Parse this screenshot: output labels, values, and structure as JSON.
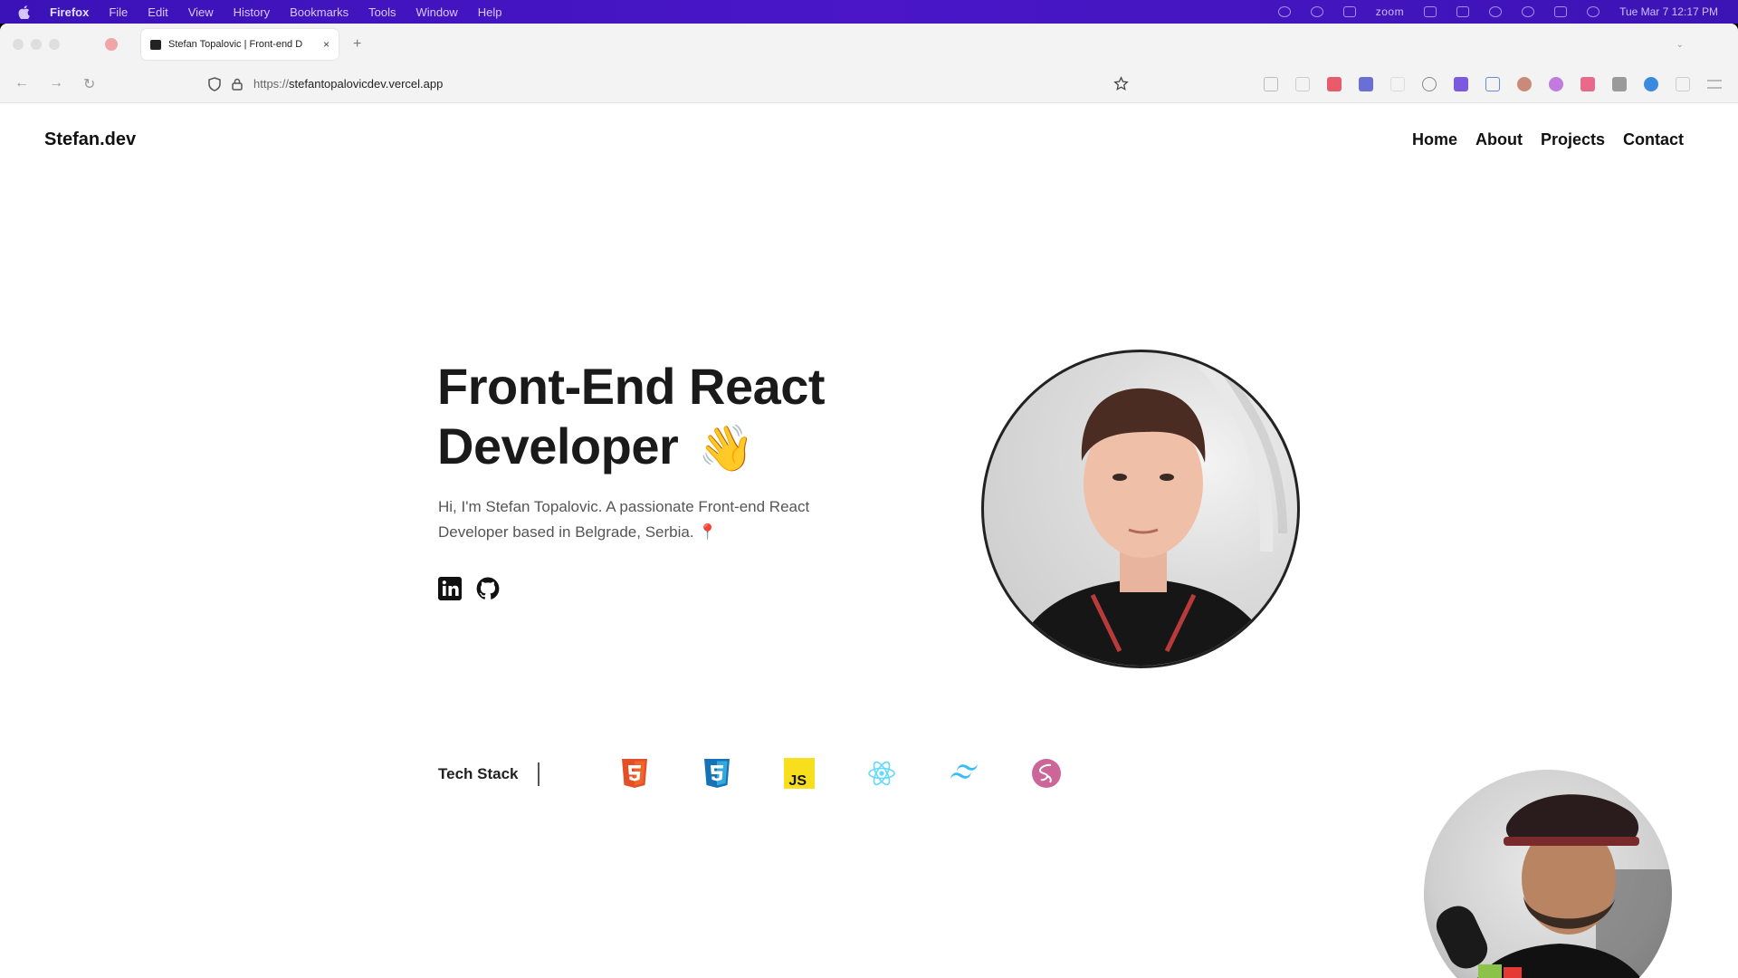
{
  "menubar": {
    "app_name": "Firefox",
    "items": [
      "File",
      "Edit",
      "View",
      "History",
      "Bookmarks",
      "Tools",
      "Window",
      "Help"
    ],
    "zoom_label": "zoom",
    "clock": "Tue Mar 7 12:17 PM"
  },
  "browser": {
    "tab_title": "Stefan Topalovic | Front-end D",
    "tab_close": "×",
    "new_tab": "+",
    "url_prefix": "https://",
    "url_host": "stefantopalovicdev.vercel.app"
  },
  "site": {
    "logo": "Stefan.dev",
    "nav": [
      "Home",
      "About",
      "Projects",
      "Contact"
    ],
    "hero_title_line1": "Front-End React",
    "hero_title_line2": "Developer",
    "hero_emoji": "👋",
    "hero_text": "Hi, I'm Stefan Topalovic. A passionate Front-end React Developer based in Belgrade, Serbia.",
    "hero_pin": "📍",
    "tech_stack_label": "Tech Stack",
    "tech_icons": [
      "html5-icon",
      "css3-icon",
      "javascript-icon",
      "react-icon",
      "tailwind-icon",
      "sass-icon"
    ]
  },
  "colors": {
    "menubar": "#4a16c8",
    "html5": "#e34f26",
    "css3": "#1572b6",
    "js": "#f7df1e",
    "react": "#61dafb",
    "tailwind": "#38bdf8",
    "sass": "#cc6699"
  }
}
